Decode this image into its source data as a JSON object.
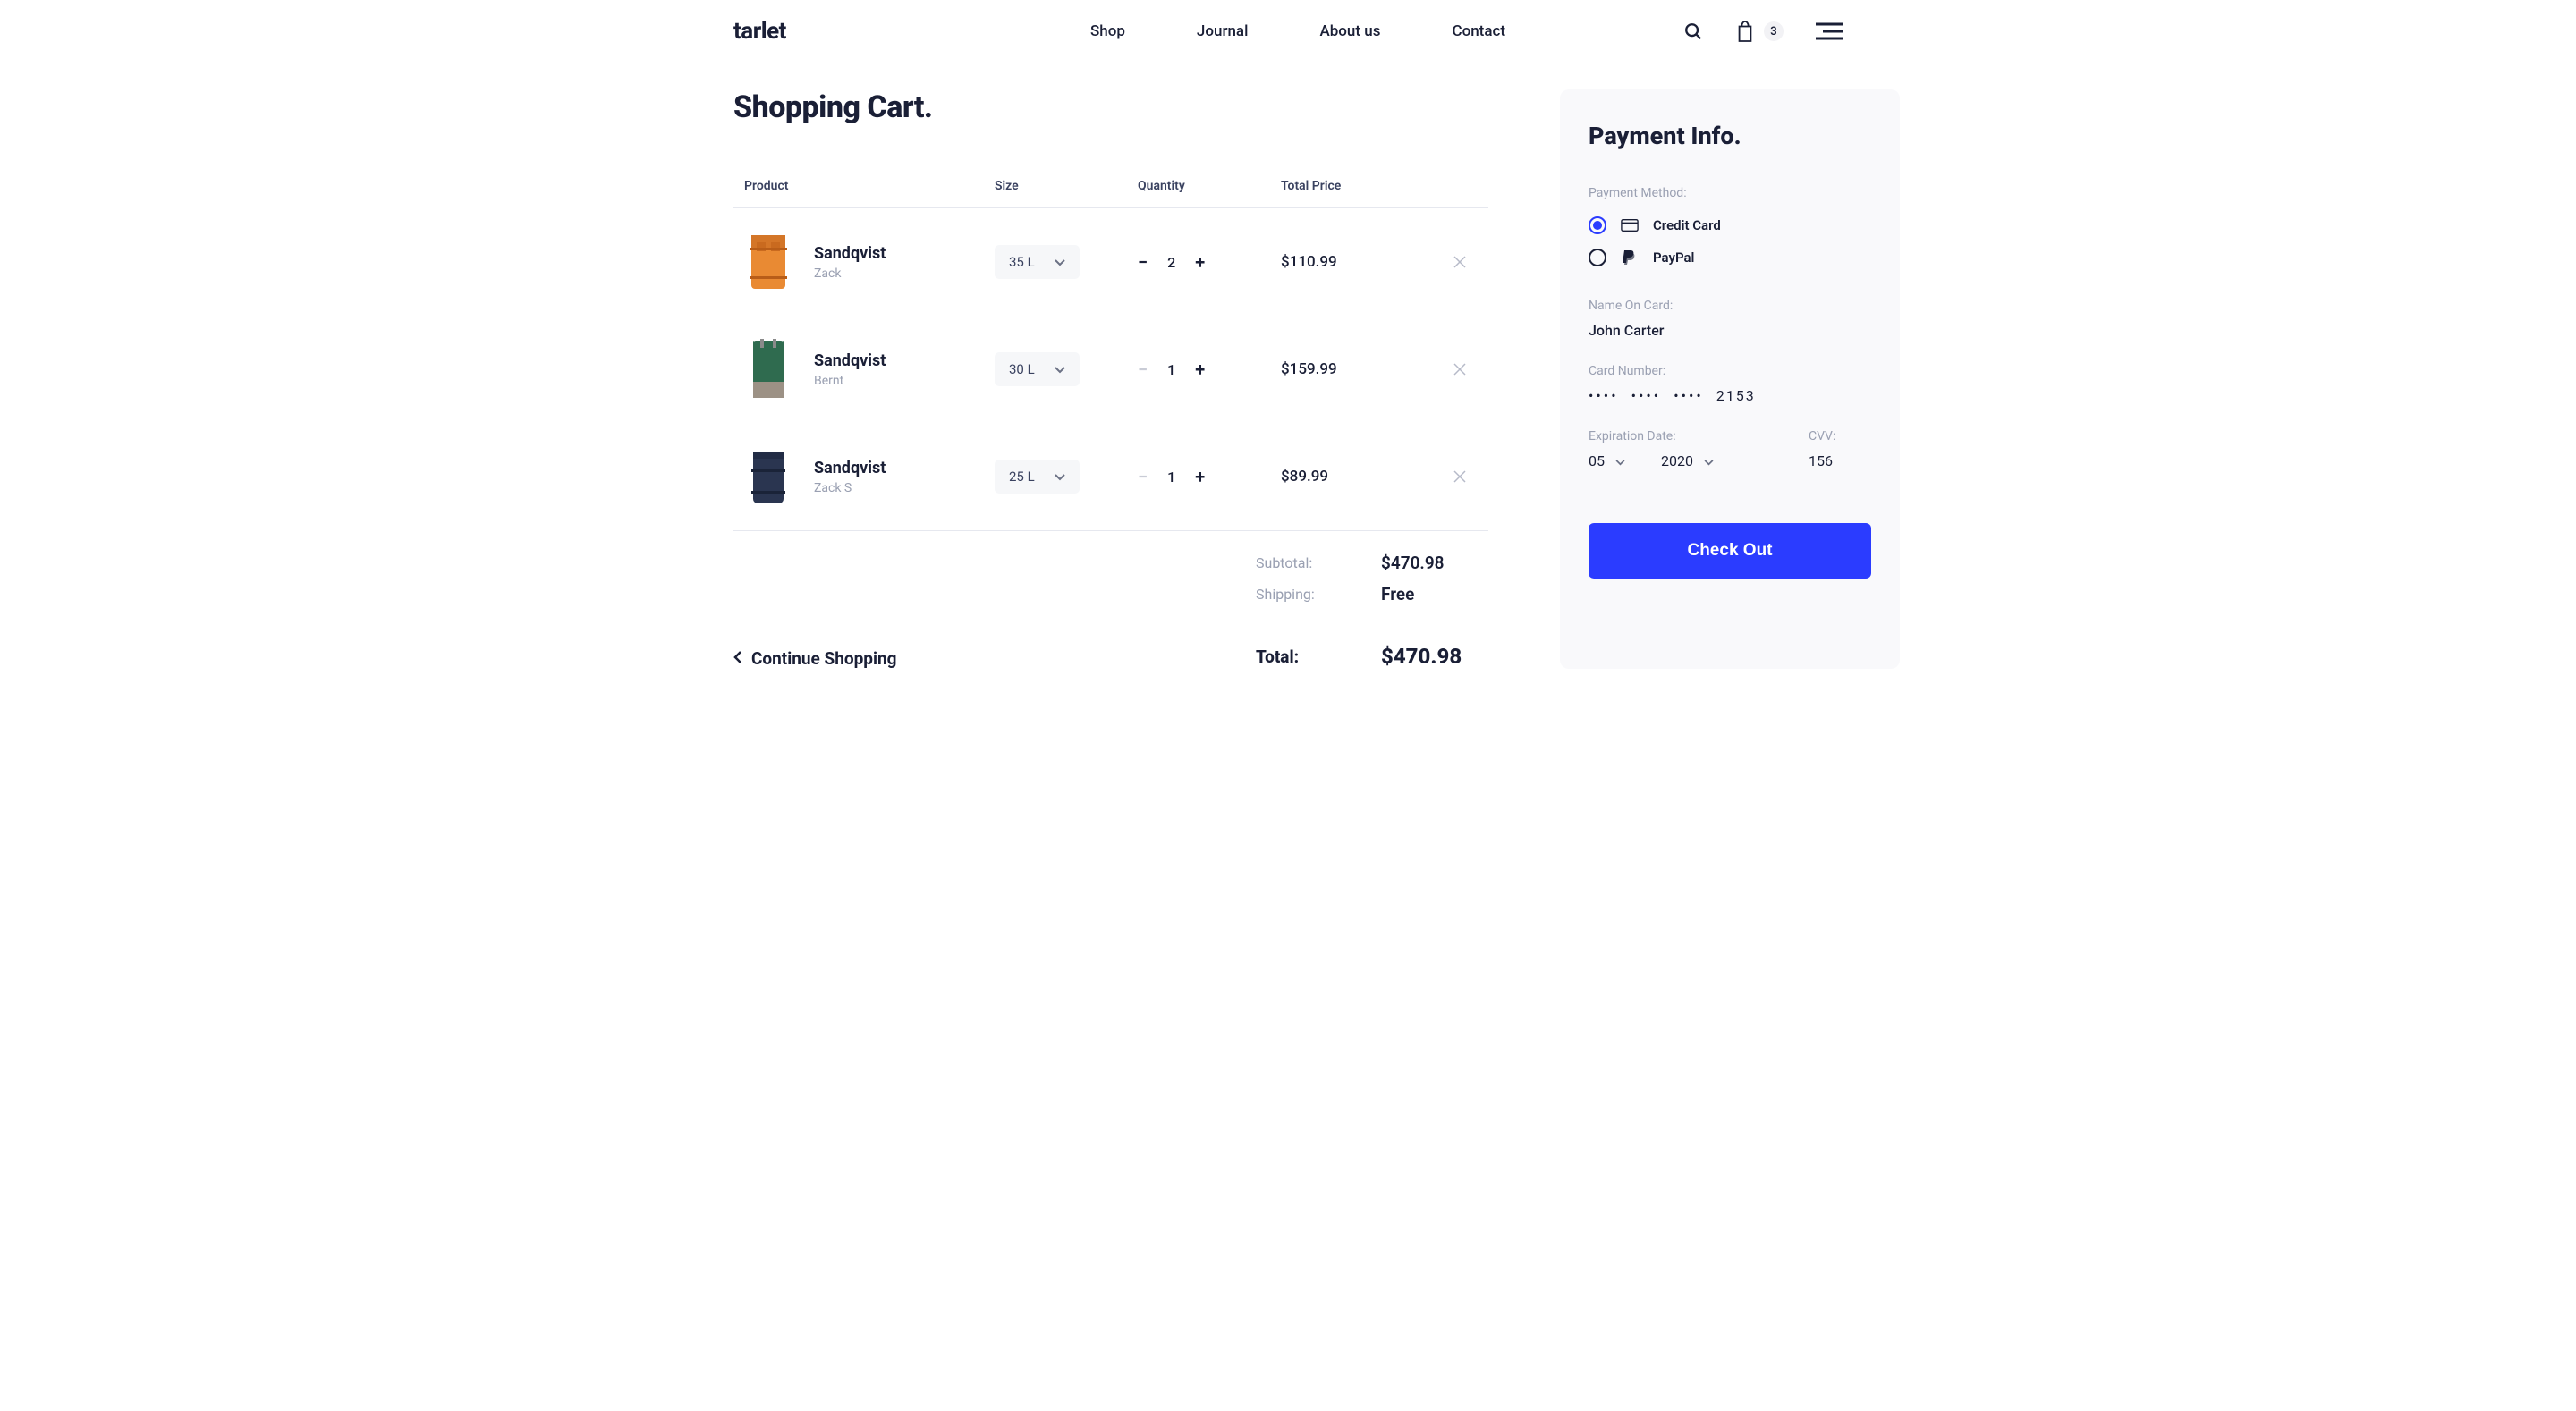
{
  "brand": "tarlet",
  "nav": [
    "Shop",
    "Journal",
    "About us",
    "Contact"
  ],
  "cart_count": "3",
  "cart_title": "Shopping Cart.",
  "columns": {
    "product": "Product",
    "size": "Size",
    "quantity": "Quantity",
    "total": "Total Price"
  },
  "items": [
    {
      "brand": "Sandqvist",
      "model": "Zack",
      "size": "35 L",
      "qty": "2",
      "price": "$110.99",
      "thumb_color": "#e98a33"
    },
    {
      "brand": "Sandqvist",
      "model": "Bernt",
      "size": "30 L",
      "qty": "1",
      "price": "$159.99",
      "thumb_color": "#2f6b4f"
    },
    {
      "brand": "Sandqvist",
      "model": "Zack S",
      "size": "25 L",
      "qty": "1",
      "price": "$89.99",
      "thumb_color": "#2a3550"
    }
  ],
  "subtotal_label": "Subtotal:",
  "subtotal_value": "$470.98",
  "shipping_label": "Shipping:",
  "shipping_value": "Free",
  "total_label": "Total:",
  "total_value": "$470.98",
  "continue_label": "Continue Shopping",
  "payment": {
    "title": "Payment Info.",
    "method_label": "Payment Method:",
    "methods": [
      {
        "id": "credit",
        "label": "Credit Card",
        "selected": true
      },
      {
        "id": "paypal",
        "label": "PayPal",
        "selected": false
      }
    ],
    "name_label": "Name On Card:",
    "name_value": "John Carter",
    "card_label": "Card Number:",
    "card_mask": [
      "••••",
      "••••",
      "••••"
    ],
    "card_last4": "2153",
    "exp_label": "Expiration Date:",
    "exp_month": "05",
    "exp_year": "2020",
    "cvv_label": "CVV:",
    "cvv_value": "156",
    "checkout_label": "Check Out"
  }
}
